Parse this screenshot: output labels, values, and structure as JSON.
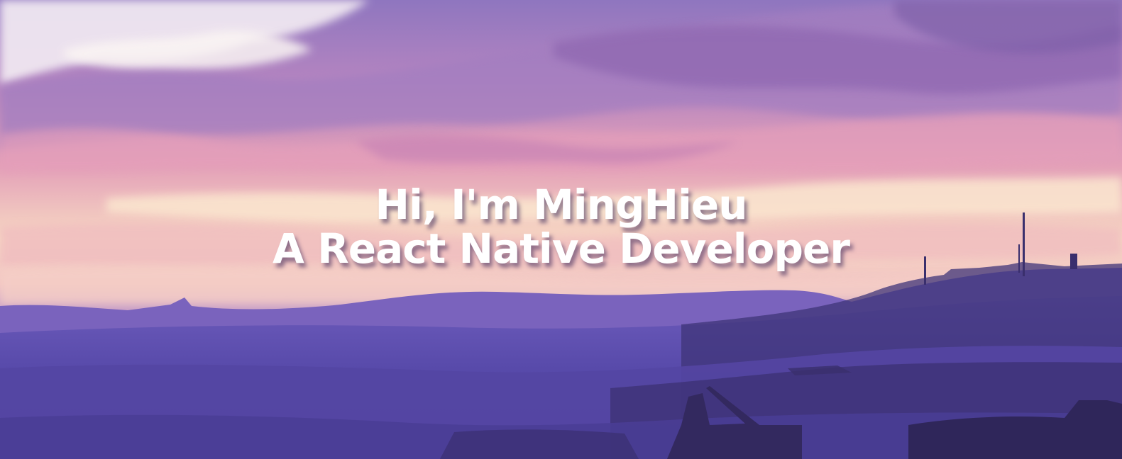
{
  "hero": {
    "greeting": "Hi, I'm MingHieu",
    "role": "A React Native Developer"
  },
  "colors": {
    "sky_top": "#8b6fb8",
    "sky_mid": "#d58db3",
    "sky_glow": "#f6d9c2",
    "land_far": "#7d67bf",
    "land_near": "#4a3f9a",
    "land_dark": "#3b2f6e",
    "text": "#ffffff"
  }
}
